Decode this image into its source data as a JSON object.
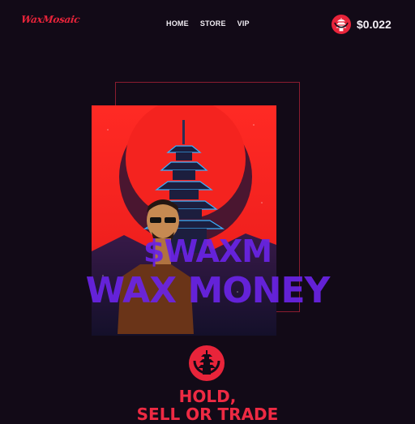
{
  "header": {
    "logo_text": "WaxMosaic",
    "nav": [
      {
        "label": "HOME"
      },
      {
        "label": "STORE"
      },
      {
        "label": "VIP"
      }
    ],
    "price": "$0.022",
    "price_icon": "pagoda-coin-icon"
  },
  "hero": {
    "title_line_1": "$WAXM",
    "title_line_2": "WAX MONEY",
    "image": "pagoda-moon-artwork"
  },
  "section": {
    "emblem_icon": "pagoda-emblem-icon",
    "heading_line_1": "HOLD,",
    "heading_line_2": "SELL OR TRADE"
  },
  "colors": {
    "background": "#120a17",
    "accent_red": "#e8243a",
    "title_purple": "#6a24e6"
  }
}
